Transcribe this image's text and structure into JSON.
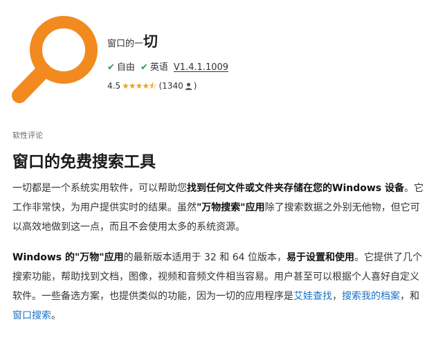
{
  "app": {
    "title_prefix": "窗口的一",
    "title_main": "切",
    "tags": {
      "license": "自由",
      "language": "英语",
      "version": "V1.4.1.1009"
    },
    "rating": {
      "score": "4.5",
      "stars_value": 4.5,
      "count_open": "(1340",
      "count_close": ")"
    },
    "colors": {
      "accent_orange": "#f28a1f",
      "check_green": "#2e9a3e",
      "star": "#f0a11d",
      "link": "#1a73c8"
    }
  },
  "review": {
    "section_label": "软性评论",
    "heading": "窗口的免费搜索工具",
    "p1": {
      "t1": "一切都是一个系统实用软件，可以帮助您",
      "b1": "找到任何文件或文件夹存储在您的Windows 设备",
      "t2": "。它工作非常快，为用户提供实时的结果。虽然",
      "b2": "\"万物搜索\"应用",
      "t3": "除了搜索数据之外别无他物，但它可以高效地做到这一点，而且不会使用太多的系统资源。"
    },
    "p2": {
      "b1": "Windows 的\"万物\"应用",
      "t1": "的最新版本适用于 32 和 64 位版本，",
      "b2": "易于设置和使用",
      "t2": "。它提供了几个搜索功能，帮助找到文档，图像，视频和音频文件相当容易。用户甚至可以根据个人喜好自定义软件。一些备选方案，也提供类似的功能，因为一切的应用程序是",
      "link1": "艾娃查找",
      "sep1": "，",
      "link2": "搜索我的档案",
      "sep2": "，和",
      "link3": "窗口搜索",
      "end": "。"
    }
  }
}
